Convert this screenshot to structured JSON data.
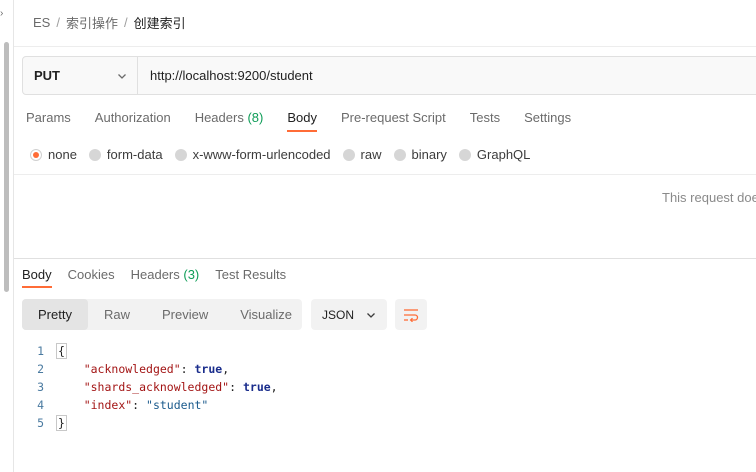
{
  "breadcrumb": {
    "items": [
      "ES",
      "索引操作",
      "创建索引"
    ],
    "separator": "/"
  },
  "request": {
    "method": "PUT",
    "url": "http://localhost:9200/student",
    "tabs": [
      {
        "label": "Params",
        "count": ""
      },
      {
        "label": "Authorization",
        "count": ""
      },
      {
        "label": "Headers",
        "count": "(8)"
      },
      {
        "label": "Body",
        "count": ""
      },
      {
        "label": "Pre-request Script",
        "count": ""
      },
      {
        "label": "Tests",
        "count": ""
      },
      {
        "label": "Settings",
        "count": ""
      }
    ],
    "active_tab": "Body",
    "body_types": [
      "none",
      "form-data",
      "x-www-form-urlencoded",
      "raw",
      "binary",
      "GraphQL"
    ],
    "selected_body_type": "none",
    "no_body_message": "This request doe"
  },
  "response": {
    "tabs": [
      {
        "label": "Body",
        "count": ""
      },
      {
        "label": "Cookies",
        "count": ""
      },
      {
        "label": "Headers",
        "count": "(3)"
      },
      {
        "label": "Test Results",
        "count": ""
      }
    ],
    "active_tab": "Body",
    "views": [
      "Pretty",
      "Raw",
      "Preview",
      "Visualize"
    ],
    "active_view": "Pretty",
    "format": "JSON",
    "code": {
      "line_numbers": [
        "1",
        "2",
        "3",
        "4",
        "5"
      ],
      "open_brace": "{",
      "close_brace": "}",
      "entries": [
        {
          "key": "\"acknowledged\"",
          "value": "true",
          "trailing": ","
        },
        {
          "key": "\"shards_acknowledged\"",
          "value": "true",
          "trailing": ","
        },
        {
          "key": "\"index\"",
          "value": "\"student\"",
          "trailing": ""
        }
      ]
    }
  },
  "colors": {
    "accent": "#ff6c37",
    "count_green": "#0f9d58"
  }
}
